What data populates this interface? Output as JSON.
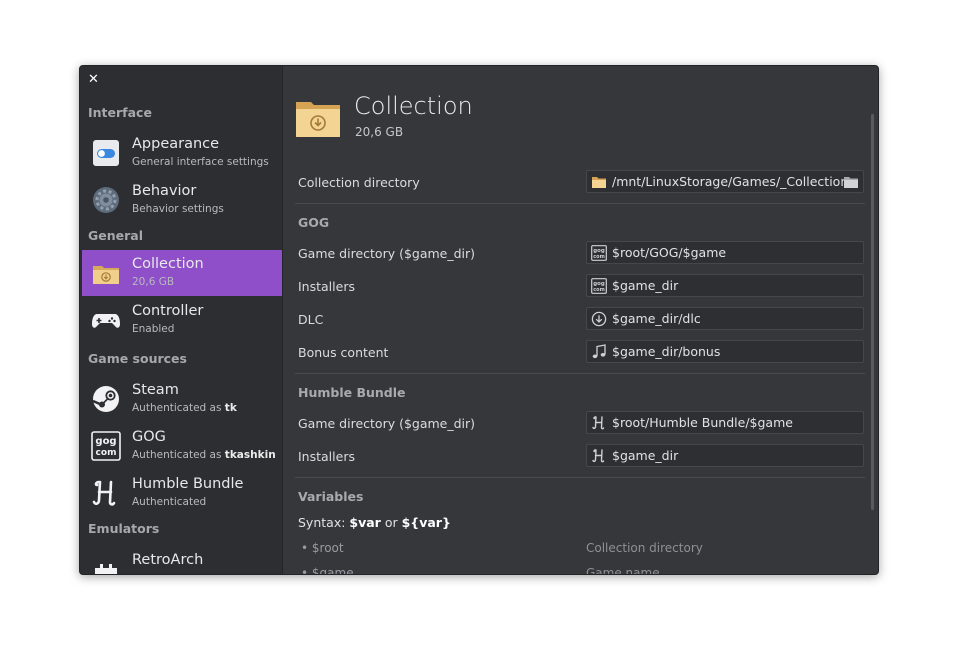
{
  "window": {
    "close_label": "✕"
  },
  "sidebar": {
    "sections": {
      "interface": "Interface",
      "general": "General",
      "game_sources": "Game sources",
      "emulators": "Emulators"
    },
    "items": [
      {
        "title": "Appearance",
        "subtitle": "General interface settings"
      },
      {
        "title": "Behavior",
        "subtitle": "Behavior settings"
      },
      {
        "title": "Collection",
        "subtitle": "20,6 GB"
      },
      {
        "title": "Controller",
        "subtitle": "Enabled"
      },
      {
        "title": "Steam",
        "subtitle_prefix": "Authenticated as ",
        "subtitle_user": "tk"
      },
      {
        "title": "GOG",
        "subtitle_prefix": "Authenticated as ",
        "subtitle_user": "tkashkin"
      },
      {
        "title": "Humble Bundle",
        "subtitle": "Authenticated"
      },
      {
        "title": "RetroArch",
        "subtitle": ""
      }
    ]
  },
  "main": {
    "title": "Collection",
    "size": "20,6 GB",
    "collection_directory": {
      "label": "Collection directory",
      "value": "/mnt/LinuxStorage/Games/_Collection"
    },
    "gog": {
      "title": "GOG",
      "rows": [
        {
          "label": "Game directory ($game_dir)",
          "value": "$root/GOG/$game",
          "icon": "gog-icon"
        },
        {
          "label": "Installers",
          "value": "$game_dir",
          "icon": "gog-icon"
        },
        {
          "label": "DLC",
          "value": "$game_dir/dlc",
          "icon": "download-icon"
        },
        {
          "label": "Bonus content",
          "value": "$game_dir/bonus",
          "icon": "music-note-icon"
        }
      ]
    },
    "humble": {
      "title": "Humble Bundle",
      "rows": [
        {
          "label": "Game directory ($game_dir)",
          "value": "$root/Humble Bundle/$game",
          "icon": "humble-icon"
        },
        {
          "label": "Installers",
          "value": "$game_dir",
          "icon": "humble-icon"
        }
      ]
    },
    "variables": {
      "title": "Variables",
      "syntax_prefix": "Syntax: ",
      "syntax_var": "$var",
      "syntax_or": " or ",
      "syntax_braced": "${var}",
      "items": [
        {
          "name": "• $root",
          "desc": "Collection directory"
        },
        {
          "name": "• $game",
          "desc": "Game name"
        }
      ]
    }
  },
  "colors": {
    "accent": "#8e4fc9",
    "background": "#36373b",
    "sidebar": "#2d2e32"
  }
}
